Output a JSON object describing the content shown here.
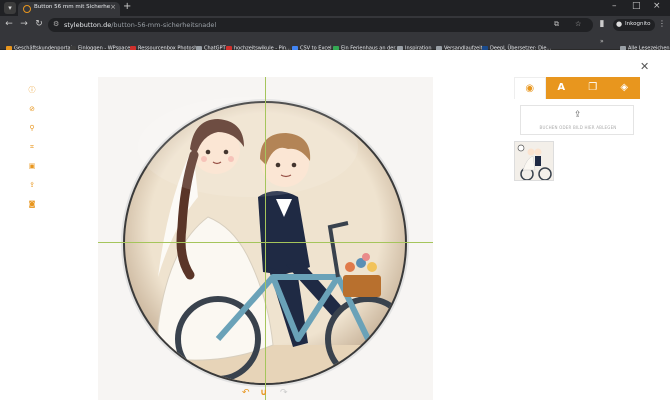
{
  "browser": {
    "tab_title": "Button 56 mm mit Sicherheitsnadel",
    "url_domain": "stylebutton.de",
    "url_path": "/button-56-mm-sicherheitsnadel",
    "incognito_label": "Inkognito",
    "bookmarks": [
      {
        "label": "Geschäftskundenportal",
        "color": "#e8961e"
      },
      {
        "label": "Einloggen - WPspace",
        "color": "#3c3c3c"
      },
      {
        "label": "Ressourcenbox Photosh...",
        "color": "#d0312d"
      },
      {
        "label": "ChatGPT",
        "color": "#9aa0a6"
      },
      {
        "label": "hochzeitswikule - Pin...",
        "color": "#d0312d"
      },
      {
        "label": "CSV to Excel",
        "color": "#4285f4"
      },
      {
        "label": "Ein Ferienhaus an der...",
        "color": "#34a853"
      },
      {
        "label": "Inspiration",
        "color": "#9aa0a6"
      },
      {
        "label": "Versandlaufzeit",
        "color": "#9aa0a6"
      },
      {
        "label": "DeepL Übersetzer: Die...",
        "color": "#1b4a8a"
      }
    ],
    "reading_list_label": "Alle Lesezeichen"
  },
  "editor": {
    "upload_text": "BUCHEN ODER BILD HIER ABLEGEN",
    "accent_color": "#e8961e"
  }
}
